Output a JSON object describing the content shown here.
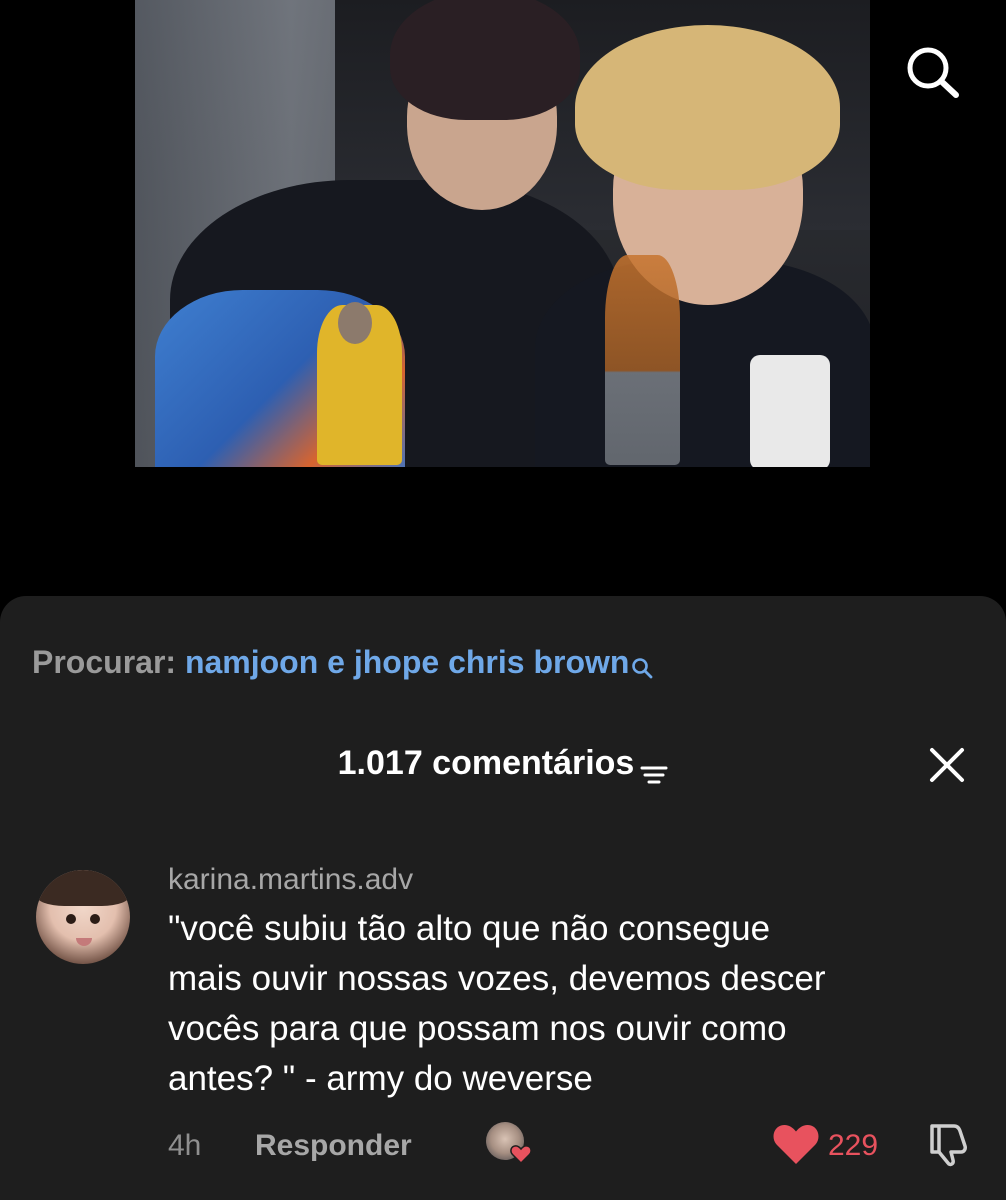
{
  "video": {
    "top_search_icon": "search-icon"
  },
  "sheet": {
    "search_suggestion": {
      "label": "Procurar:",
      "query": "namjoon e jhope chris brown",
      "icon": "search-icon"
    },
    "header": {
      "title": "1.017 comentários",
      "filter_icon": "filter-icon",
      "close_icon": "close-icon"
    },
    "comments": [
      {
        "username": "karina.martins.adv",
        "text_lines": [
          "\"você subiu tão alto que não consegue",
          "mais ouvir nossas vozes, devemos descer",
          "vocês para que possam nos ouvir como",
          "antes? \" - army do weverse"
        ],
        "time": "4h",
        "reply_label": "Responder",
        "liked_by_creator": true,
        "likes": "229",
        "like_color": "#e8525e",
        "liked": true
      }
    ]
  },
  "colors": {
    "sheet_bg": "#1e1e1e",
    "query_link": "#6fa8e8",
    "heart_red": "#e8525e"
  }
}
